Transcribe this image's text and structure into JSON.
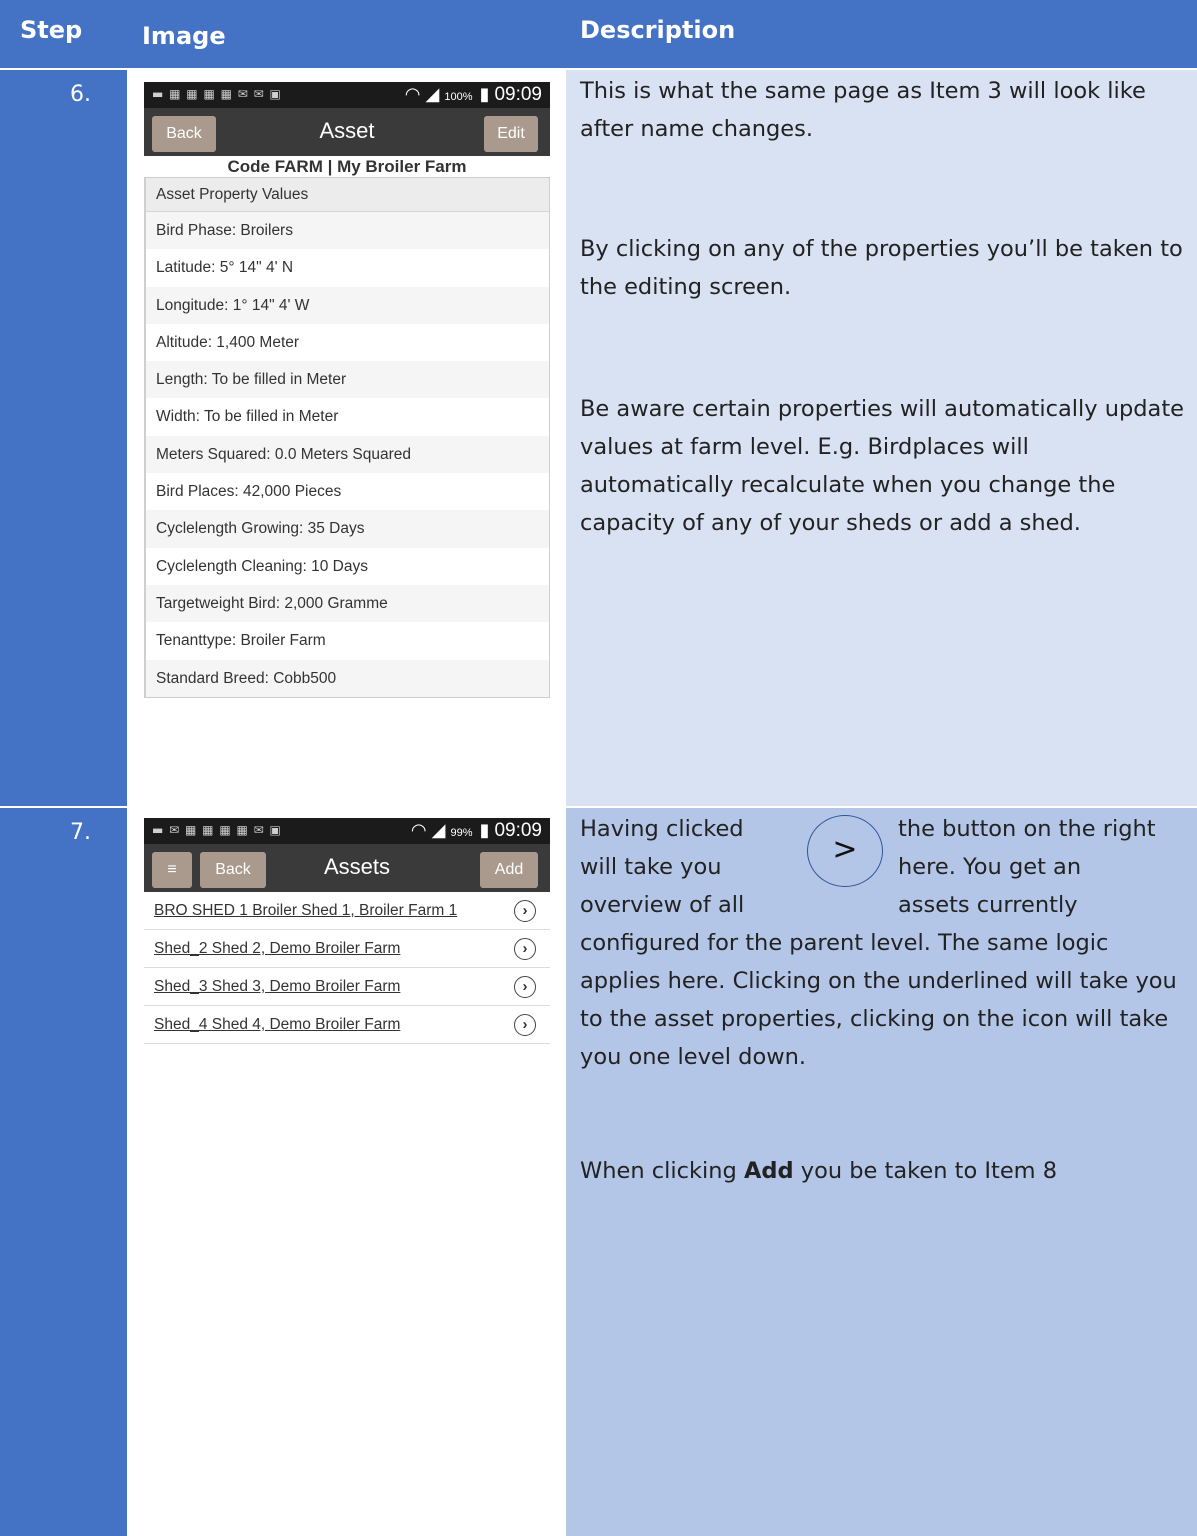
{
  "header": {
    "step": "Step",
    "image": "Image",
    "description": "Description"
  },
  "rows": [
    {
      "step": "6.",
      "phone": {
        "status_battery": "100%",
        "status_time": "09:09",
        "back_label": "Back",
        "title": "Asset",
        "edit_label": "Edit",
        "subtitle": "Code FARM | My Broiler Farm",
        "list_header": "Asset Property Values",
        "properties": [
          "Bird Phase: Broilers",
          "Latitude: 5° 14\" 4' N",
          "Longitude: 1° 14\" 4' W",
          "Altitude: 1,400 Meter",
          "Length: To be filled in Meter",
          "Width: To be filled in Meter",
          "Meters Squared: 0.0 Meters Squared",
          "Bird Places: 42,000 Pieces",
          "Cyclelength Growing: 35 Days",
          "Cyclelength Cleaning: 10 Days",
          "Targetweight Bird: 2,000 Gramme",
          "Tenanttype: Broiler Farm",
          "Standard Breed: Cobb500"
        ]
      },
      "description": {
        "p1": "This is what the same page as Item 3 will look like after name changes.",
        "p2": "By clicking on any of the properties you’ll be taken to the editing screen.",
        "p3": "Be aware certain properties will automatically update values at farm level. E.g. Birdplaces will automatically recalculate when you change the capacity of any of your sheds or add a shed."
      }
    },
    {
      "step": "7.",
      "phone": {
        "status_battery": "99%",
        "status_time": "09:09",
        "menu_icon": "≡",
        "back_label": "Back",
        "title": "Assets",
        "add_label": "Add",
        "assets": [
          "BRO SHED 1 Broiler Shed 1, Broiler Farm 1",
          "Shed_2 Shed 2, Demo Broiler Farm",
          "Shed_3 Shed 3, Demo Broiler Farm",
          "Shed_4 Shed 4, Demo Broiler Farm"
        ]
      },
      "description": {
        "callout_symbol": ">",
        "line1a": "Having clicked",
        "line1b": "the button on the right",
        "line2a": "will take you",
        "line2b": "here. You get an",
        "line3a": "overview of all",
        "line3b": "assets currently",
        "rest": "configured for the parent level. The same logic applies here. Clicking on the underlined will take you to the asset properties, clicking on the icon will take you one level down.",
        "add_pre": "When clicking ",
        "add_bold": "Add",
        "add_post": " you be taken to Item 8"
      }
    }
  ],
  "colors": {
    "header_bg": "#4472c4",
    "row6_desc_bg": "#d9e2f3",
    "row7_desc_bg": "#b4c6e7"
  }
}
